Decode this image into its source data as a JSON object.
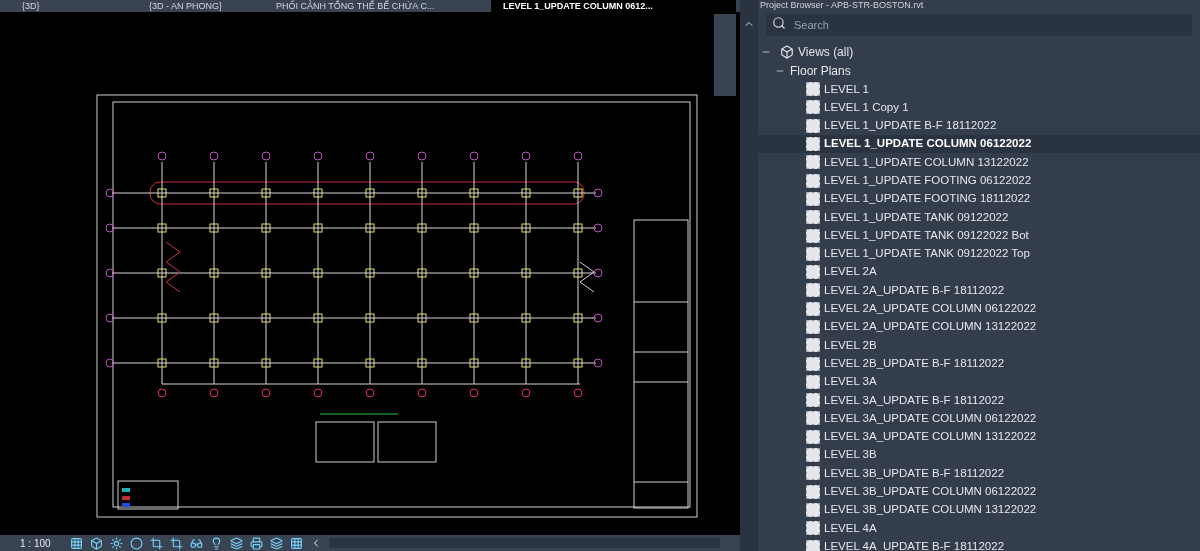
{
  "view_tabs": [
    {
      "label": "{3D}",
      "selected": false
    },
    {
      "label": "{3D - AN PHONG}",
      "selected": false
    },
    {
      "label": "PHỐI CẢNH TỔNG THỂ BỂ CHỨA C...",
      "selected": false
    },
    {
      "label": "LEVEL 1_UPDATE COLUMN 0612...",
      "selected": true
    }
  ],
  "view_status_bar": {
    "scale": "1 : 100"
  },
  "project_browser": {
    "title": "Project Browser - APB-STR-BOSTON.rvt",
    "search": {
      "placeholder": "Search"
    },
    "tree": [
      {
        "label": "Views (all)",
        "expanded": true,
        "children": [
          {
            "label": "Floor Plans",
            "expanded": true,
            "children": [
              {
                "label": "LEVEL 1",
                "selected": false
              },
              {
                "label": "LEVEL 1 Copy 1",
                "selected": false
              },
              {
                "label": "LEVEL 1_UPDATE B-F 18112022",
                "selected": false
              },
              {
                "label": "LEVEL 1_UPDATE COLUMN 06122022",
                "selected": true
              },
              {
                "label": "LEVEL 1_UPDATE COLUMN 13122022",
                "selected": false
              },
              {
                "label": "LEVEL 1_UPDATE FOOTING 06122022",
                "selected": false
              },
              {
                "label": "LEVEL 1_UPDATE FOOTING 18112022",
                "selected": false
              },
              {
                "label": "LEVEL 1_UPDATE TANK 09122022",
                "selected": false
              },
              {
                "label": "LEVEL 1_UPDATE TANK 09122022 Bot",
                "selected": false
              },
              {
                "label": "LEVEL 1_UPDATE TANK 09122022 Top",
                "selected": false
              },
              {
                "label": "LEVEL 2A",
                "selected": false
              },
              {
                "label": "LEVEL 2A_UPDATE B-F 18112022",
                "selected": false
              },
              {
                "label": "LEVEL 2A_UPDATE COLUMN 06122022",
                "selected": false
              },
              {
                "label": "LEVEL 2A_UPDATE COLUMN 13122022",
                "selected": false
              },
              {
                "label": "LEVEL 2B",
                "selected": false
              },
              {
                "label": "LEVEL 2B_UPDATE B-F 18112022",
                "selected": false
              },
              {
                "label": "LEVEL 3A",
                "selected": false
              },
              {
                "label": "LEVEL 3A_UPDATE B-F 18112022",
                "selected": false
              },
              {
                "label": "LEVEL 3A_UPDATE COLUMN 06122022",
                "selected": false
              },
              {
                "label": "LEVEL 3A_UPDATE COLUMN 13122022",
                "selected": false
              },
              {
                "label": "LEVEL 3B",
                "selected": false
              },
              {
                "label": "LEVEL 3B_UPDATE B-F 18112022",
                "selected": false
              },
              {
                "label": "LEVEL 3B_UPDATE COLUMN 06122022",
                "selected": false
              },
              {
                "label": "LEVEL 3B_UPDATE COLUMN 13122022",
                "selected": false
              },
              {
                "label": "LEVEL 4A",
                "selected": false
              },
              {
                "label": "LEVEL 4A_UPDATE B-F 18112022",
                "selected": false
              }
            ]
          }
        ]
      }
    ]
  }
}
